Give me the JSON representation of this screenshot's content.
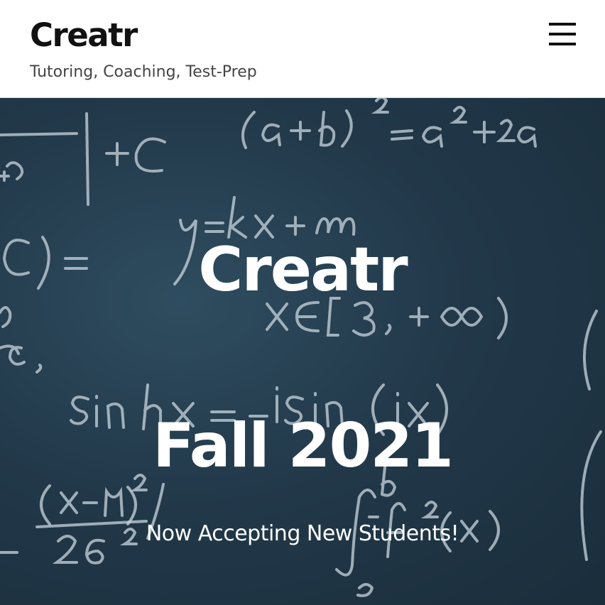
{
  "header": {
    "site_title": "Creatr",
    "tagline": "Tutoring, Coaching, Test-Prep",
    "menu_icon": "hamburger-menu-icon"
  },
  "hero": {
    "title": "Creatr",
    "subtitle": "Fall 2021",
    "tagline": "Now Accepting New Students!",
    "background_image": "chalkboard-math-formulas"
  },
  "colors": {
    "header_bg": "#ffffff",
    "title_text": "#111111",
    "tagline_text": "#444444",
    "hero_bg": "#22394a",
    "hero_text": "#ffffff",
    "chalk": "#c9d6dd"
  }
}
